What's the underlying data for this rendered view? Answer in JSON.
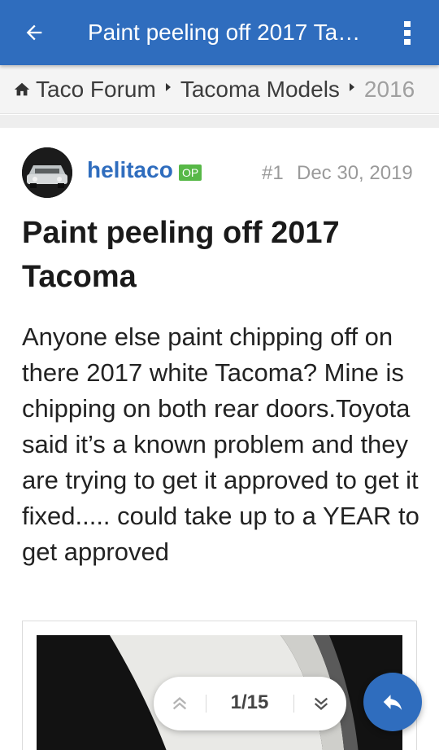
{
  "appbar": {
    "title": "Paint peeling off 2017 Tacoma",
    "back_icon": "arrow-left-icon",
    "menu_icon": "more-vertical-icon",
    "color": "#2f6dbe"
  },
  "breadcrumb": {
    "items": [
      "Taco Forum",
      "Tacoma Models",
      "2016"
    ]
  },
  "post": {
    "username": "helitaco",
    "op_badge": "OP",
    "post_number": "#1",
    "date": "Dec 30, 2019",
    "title": "Paint peeling off 2017 Tacoma",
    "body": "Anyone else paint chipping off on there 2017 white Tacoma? Mine is chipping on both rear doors.Toyota said it’s a known problem and they are trying to get it approved to get it fixed..... could take up to a YEAR to get approved"
  },
  "pager": {
    "label": "1/15",
    "up_icon": "double-chevron-up-icon",
    "down_icon": "double-chevron-down-icon"
  },
  "fab": {
    "icon": "reply-icon"
  }
}
